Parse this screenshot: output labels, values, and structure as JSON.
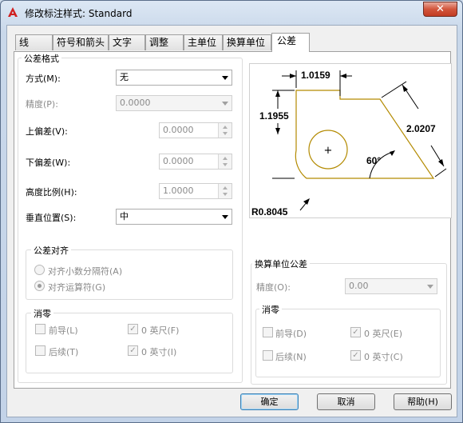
{
  "window": {
    "title": "修改标注样式: Standard",
    "close_glyph": "✕"
  },
  "tabs": [
    {
      "label": "线"
    },
    {
      "label": "符号和箭头"
    },
    {
      "label": "文字"
    },
    {
      "label": "调整"
    },
    {
      "label": "主单位"
    },
    {
      "label": "换算单位"
    },
    {
      "label": "公差",
      "active": true
    }
  ],
  "tolerance_format": {
    "group_title": "公差格式",
    "method_label": "方式(M):",
    "method_value": "无",
    "precision_label": "精度(P):",
    "precision_value": "0.0000",
    "upper_label": "上偏差(V):",
    "upper_value": "0.0000",
    "lower_label": "下偏差(W):",
    "lower_value": "0.0000",
    "height_label": "高度比例(H):",
    "height_value": "1.0000",
    "vpos_label": "垂直位置(S):",
    "vpos_value": "中"
  },
  "tolerance_align": {
    "group_title": "公差对齐",
    "opt1": "对齐小数分隔符(A)",
    "opt2": "对齐运算符(G)",
    "selected": "opt2"
  },
  "zero_suppress_left": {
    "group_title": "消零",
    "leading": "前导(L)",
    "trailing": "后续(T)",
    "zero_feet": "0 英尺(F)",
    "zero_inches": "0 英寸(I)"
  },
  "preview": {
    "dim_top": "1.0159",
    "dim_left": "1.1955",
    "dim_right": "2.0207",
    "angle": "60°",
    "radius": "R0.8045",
    "center_mark": "+"
  },
  "alt_units": {
    "group_title": "换算单位公差",
    "precision_label": "精度(O):",
    "precision_value": "0.00",
    "zero_title": "消零",
    "leading": "前导(D)",
    "trailing": "后续(N)",
    "zero_feet": "0 英尺(E)",
    "zero_inches": "0 英寸(C)"
  },
  "buttons": {
    "ok": "确定",
    "cancel": "取消",
    "help": "帮助(H)"
  },
  "check_glyph": "✓",
  "colors": {
    "shape_outline": "#b38a00",
    "close_button": "#c23b22",
    "icon_red": "#d02020"
  }
}
